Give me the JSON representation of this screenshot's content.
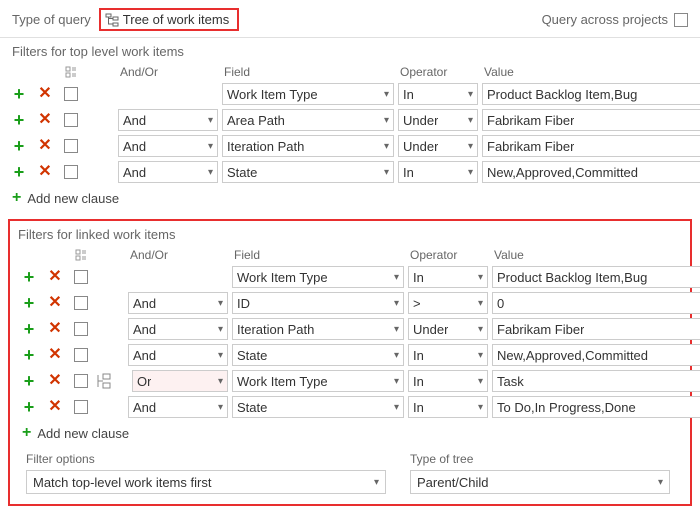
{
  "top": {
    "type_of_query_label": "Type of query",
    "query_type": "Tree of work items",
    "query_across_label": "Query across projects"
  },
  "headers": {
    "and_or": "And/Or",
    "field": "Field",
    "operator": "Operator",
    "value": "Value"
  },
  "top_filters": {
    "title": "Filters for top level work items",
    "rows": [
      {
        "andor": "",
        "field": "Work Item Type",
        "op": "In",
        "value": "Product Backlog Item,Bug"
      },
      {
        "andor": "And",
        "field": "Area Path",
        "op": "Under",
        "value": "Fabrikam Fiber"
      },
      {
        "andor": "And",
        "field": "Iteration Path",
        "op": "Under",
        "value": "Fabrikam Fiber"
      },
      {
        "andor": "And",
        "field": "State",
        "op": "In",
        "value": "New,Approved,Committed"
      }
    ],
    "add_label": "Add new clause"
  },
  "linked_filters": {
    "title": "Filters for linked work items",
    "rows": [
      {
        "indent": false,
        "andor": "",
        "field": "Work Item Type",
        "op": "In",
        "value": "Product Backlog Item,Bug"
      },
      {
        "indent": false,
        "andor": "And",
        "field": "ID",
        "op": ">",
        "value": "0"
      },
      {
        "indent": false,
        "andor": "And",
        "field": "Iteration Path",
        "op": "Under",
        "value": "Fabrikam Fiber"
      },
      {
        "indent": false,
        "andor": "And",
        "field": "State",
        "op": "In",
        "value": "New,Approved,Committed"
      },
      {
        "indent": true,
        "andor": "Or",
        "field": "Work Item Type",
        "op": "In",
        "value": "Task"
      },
      {
        "indent": false,
        "andor": "And",
        "field": "State",
        "op": "In",
        "value": "To Do,In Progress,Done"
      }
    ],
    "add_label": "Add new clause"
  },
  "options": {
    "filter_options_label": "Filter options",
    "filter_options_value": "Match top-level work items first",
    "tree_type_label": "Type of tree",
    "tree_type_value": "Parent/Child"
  }
}
